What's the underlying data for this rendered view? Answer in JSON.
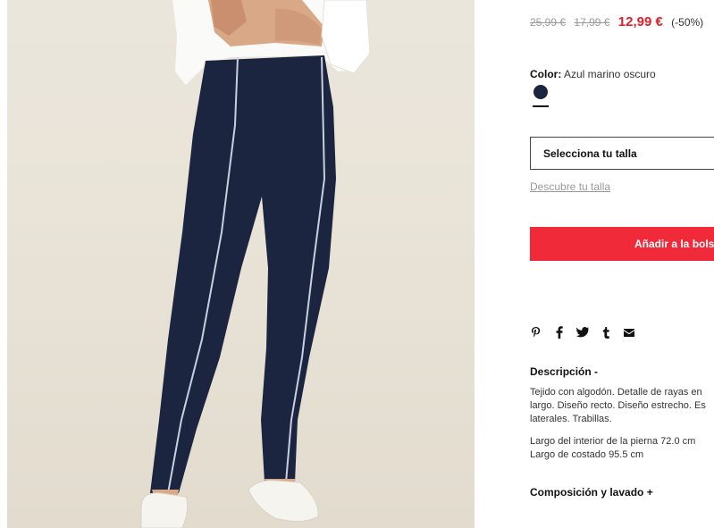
{
  "product": {
    "price_original": "25,99 €",
    "price_previous": "17,99 €",
    "price_current": "12,99 €",
    "discount": "(-50%)",
    "color_label": "Color:",
    "color_value": "Azul marino oscuro",
    "swatch_color": "#1b2540"
  },
  "size": {
    "select_label": "Selecciona tu talla",
    "guide_link": "Descubre tu talla"
  },
  "cart": {
    "add_button_label": "Añadir a la bolsa"
  },
  "share": {
    "icons": [
      "pinterest-icon",
      "facebook-icon",
      "twitter-icon",
      "tumblr-icon",
      "email-icon"
    ]
  },
  "description": {
    "title": "Descripción -",
    "lines": [
      "Tejido con algodón. Detalle de rayas en",
      "largo. Diseño recto. Diseño estrecho. Es",
      "laterales. Trabillas."
    ],
    "measurements": [
      "Largo del interior de la pierna 72.0 cm",
      "Largo de costado 95.5 cm"
    ]
  },
  "composition": {
    "title": "Composición y lavado +"
  },
  "colors": {
    "accent_red": "#f12a3a",
    "price_red": "#e11d2a",
    "pants_navy": "#1b2540"
  }
}
